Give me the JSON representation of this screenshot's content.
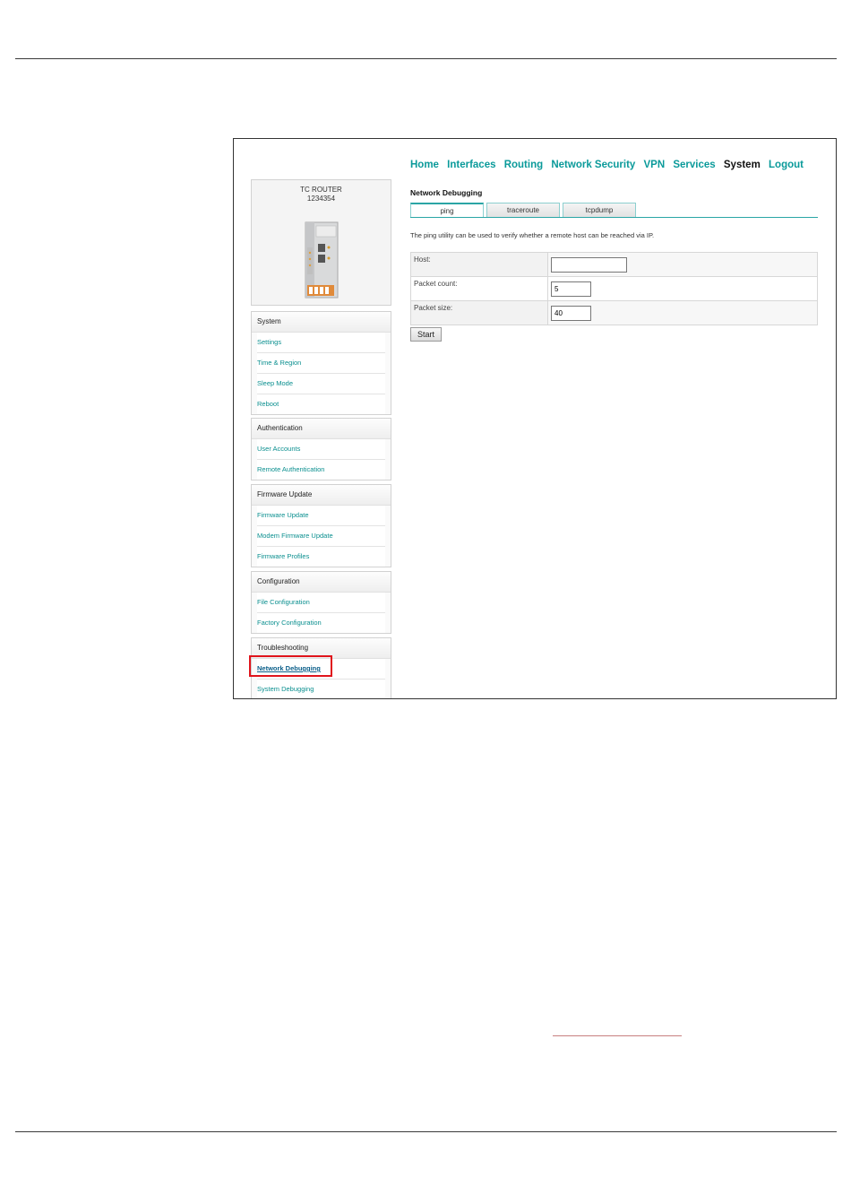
{
  "nav": [
    "Home",
    "Interfaces",
    "Routing",
    "Network Security",
    "VPN",
    "Services",
    "System",
    "Logout"
  ],
  "nav_active": "System",
  "device": {
    "name": "TC ROUTER",
    "number": "1234354"
  },
  "sidebar": {
    "sections": [
      {
        "title": "System",
        "items": [
          "Settings",
          "Time & Region",
          "Sleep Mode",
          "Reboot"
        ]
      },
      {
        "title": "Authentication",
        "items": [
          "User Accounts",
          "Remote Authentication"
        ]
      },
      {
        "title": "Firmware Update",
        "items": [
          "Firmware Update",
          "Modem Firmware Update",
          "Firmware Profiles"
        ]
      },
      {
        "title": "Configuration",
        "items": [
          "File Configuration",
          "Factory Configuration"
        ]
      },
      {
        "title": "Troubleshooting",
        "items": [
          "Network Debugging",
          "System Debugging"
        ]
      }
    ],
    "current_item": "Network Debugging"
  },
  "page": {
    "title": "Network Debugging",
    "tabs": [
      "ping",
      "traceroute",
      "tcpdump"
    ],
    "active_tab": "ping",
    "description": "The ping utility can be used to verify whether a remote host can be reached via IP.",
    "fields": [
      {
        "label": "Host:",
        "value": ""
      },
      {
        "label": "Packet count:",
        "value": "5"
      },
      {
        "label": "Packet size:",
        "value": "40"
      }
    ],
    "start_label": "Start"
  },
  "colors": {
    "link": "#0a9a9a",
    "highlight_box": "#e0141c"
  }
}
